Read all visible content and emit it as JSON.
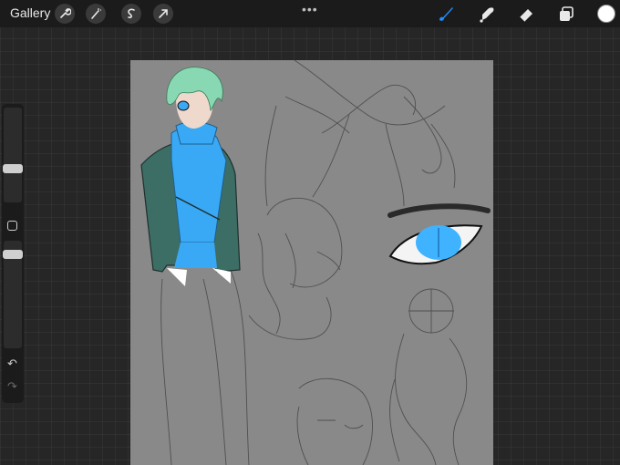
{
  "toolbar": {
    "gallery_label": "Gallery",
    "left_tools": [
      "wrench-icon",
      "magic-wand-icon",
      "selection-icon",
      "transform-arrow-icon"
    ],
    "more_label": "•••",
    "right_tools": [
      "brush-icon",
      "smudge-icon",
      "eraser-icon",
      "layers-icon"
    ],
    "active_tool": "brush-icon",
    "current_color": "#ffffff",
    "accent_color": "#1f8cff"
  },
  "sidebar": {
    "brush_size_level": 0.6,
    "opacity_level": 0.85,
    "undo_icon": "undo-icon",
    "redo_icon": "redo-icon"
  },
  "canvas": {
    "background_color": "#898989",
    "content": "character-sketch-artwork"
  }
}
